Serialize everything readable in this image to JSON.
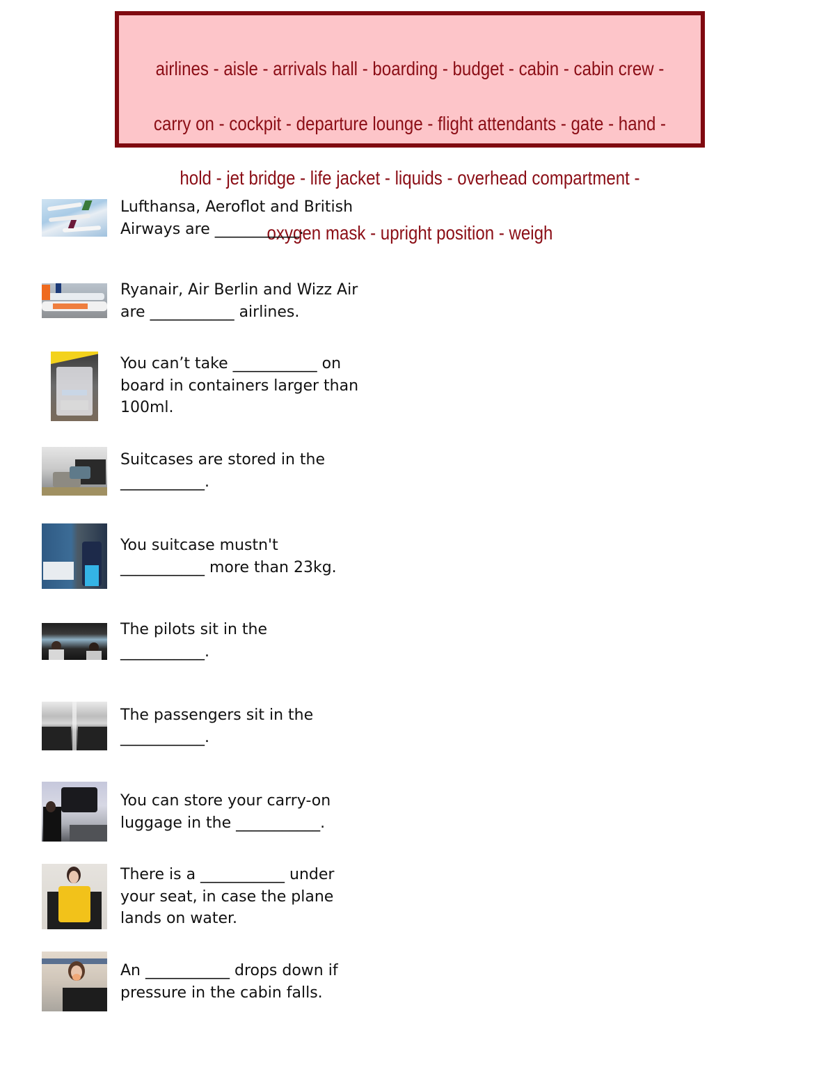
{
  "word_bank": {
    "lines": [
      "airlines - aisle - arrivals hall - boarding - budget - cabin - cabin crew -",
      "carry on - cockpit - departure lounge - flight attendants - gate - hand -",
      "hold - jet bridge - life jacket - liquids - overhead compartment -",
      "oxygen mask - upright position - weigh"
    ],
    "colors": {
      "border": "#800a10",
      "fill": "#fdc5c9",
      "text": "#8b0e16"
    }
  },
  "questions": [
    {
      "image": "airline-planes-photo",
      "text": "Lufthansa, Aeroflot and British\nAirways are ___________."
    },
    {
      "image": "easyjet-ryanair-planes-photo",
      "text": "Ryanair, Air Berlin and Wizz Air\nare ___________ airlines."
    },
    {
      "image": "liquids-bag-check-in-photo",
      "text": "You can’t take ___________ on\nboard in containers larger than\n100ml."
    },
    {
      "image": "suitcases-hold-photo",
      "text": "Suitcases are stored in the\n___________."
    },
    {
      "image": "suitcase-aisle-photo",
      "text": "You suitcase mustn't\n___________ more than 23kg."
    },
    {
      "image": "cockpit-pilots-photo",
      "text": "The pilots sit in the\n___________."
    },
    {
      "image": "cabin-seats-photo",
      "text": "The passengers sit in the\n___________."
    },
    {
      "image": "overhead-bin-photo",
      "text": "You can store your carry-on\nluggage in the ___________."
    },
    {
      "image": "life-jacket-demo-photo",
      "text": "There is a ___________ under\nyour seat, in case the plane\nlands on water."
    },
    {
      "image": "oxygen-mask-demo-photo",
      "text": "An ___________ drops down if\npressure in the cabin falls."
    }
  ]
}
